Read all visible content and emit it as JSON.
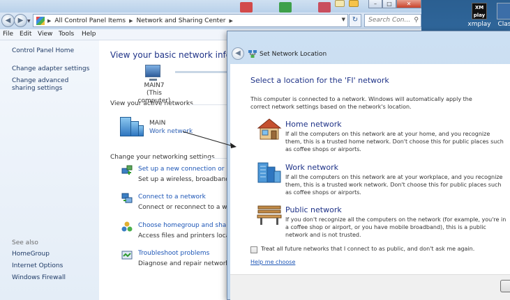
{
  "desktop": {
    "icons": [
      {
        "label": "xmplay",
        "glyph": "XM play"
      },
      {
        "label": "Clas",
        "glyph": ""
      }
    ]
  },
  "explorer": {
    "address": {
      "crumbs": [
        "All Control Panel Items",
        "Network and Sharing Center"
      ],
      "search_placeholder": "Search Con..."
    },
    "menu": [
      "File",
      "Edit",
      "View",
      "Tools",
      "Help"
    ],
    "left_pane": {
      "links": [
        "Control Panel Home",
        "Change adapter settings",
        "Change advanced sharing settings"
      ],
      "see_also_label": "See also",
      "see_also": [
        "HomeGroup",
        "Internet Options",
        "Windows Firewall"
      ]
    },
    "main": {
      "heading": "View your basic network informa",
      "computer": {
        "name": "MAIN7",
        "caption": "(This computer)"
      },
      "active_networks_label": "View your active networks",
      "network": {
        "name": "MAIN",
        "type": "Work network"
      },
      "change_settings_label": "Change your networking settings",
      "tasks": [
        {
          "link": "Set up a new connection or netw",
          "desc": "Set up a wireless, broadband, dia"
        },
        {
          "link": "Connect to a network",
          "desc": "Connect or reconnect to a wirele"
        },
        {
          "link": "Choose homegroup and sharing",
          "desc": "Access files and printers locat"
        },
        {
          "link": "Troubleshoot problems",
          "desc": "Diagnose and repair network pro"
        }
      ]
    }
  },
  "dialog": {
    "title": "Set Network Location",
    "heading": "Select a location for the 'FI' network",
    "intro": "This computer is connected to a network. Windows will automatically apply the correct network settings based on the network's location.",
    "options": [
      {
        "icon": "house-icon",
        "title": "Home network",
        "desc": "If all the computers on this network are at your home, and you recognize them, this is a trusted home network.  Don't choose this for public places such as coffee shops or airports."
      },
      {
        "icon": "office-building-icon",
        "title": "Work network",
        "desc": "If all the computers on this network are at your workplace, and you recognize them, this is a trusted work network.  Don't choose this for public places such as coffee shops or airports."
      },
      {
        "icon": "park-bench-icon",
        "title": "Public network",
        "desc": "If you don't recognize all the computers on the network (for example, you're in a coffee shop or airport, or you have mobile broadband), this is a public network and is not trusted."
      }
    ],
    "checkbox_label": "Treat all future networks that I connect to as public, and don't ask me again.",
    "checkbox_checked": false,
    "help_link": "Help me choose"
  },
  "colors": {
    "link": "#1c55b6",
    "heading": "#1e3287",
    "dialog_frame": "#c6dbf0"
  }
}
